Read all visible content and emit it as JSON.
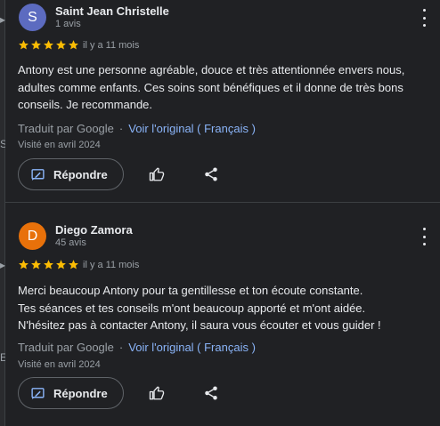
{
  "colors": {
    "avatar_1": "#5c6bc0",
    "avatar_2": "#e8710a",
    "star": "#fbbc04",
    "link": "#8ab4f8"
  },
  "rating_icon": "star-icon",
  "reviews": [
    {
      "avatar_letter": "S",
      "name": "Saint Jean Christelle",
      "count": "1 avis",
      "rating": 5,
      "date": "il y a 11 mois",
      "text_lines": [
        "Antony est une personne agréable, douce et très attentionnée envers nous,",
        "adultes comme enfants. Ces soins sont bénéfiques et il donne de très bons",
        "conseils. Je recommande."
      ],
      "translated_by": "Traduit par Google",
      "separator": "·",
      "see_original": "Voir l'original ( Français )",
      "visited": "Visité en avril 2024",
      "reply_label": "Répondre"
    },
    {
      "avatar_letter": "D",
      "name": "Diego Zamora",
      "count": "45 avis",
      "rating": 5,
      "date": "il y a 11 mois",
      "text_lines": [
        "Merci beaucoup Antony pour ta gentillesse et ton écoute constante.",
        "Tes séances et tes conseils m'ont beaucoup apporté et m'ont aidée.",
        "N'hésitez pas à contacter Antony, il saura vous écouter et vous guider !"
      ],
      "translated_by": "Traduit par Google",
      "separator": "·",
      "see_original": "Voir l'original ( Français )",
      "visited": "Visité en avril 2024",
      "reply_label": "Répondre"
    }
  ]
}
